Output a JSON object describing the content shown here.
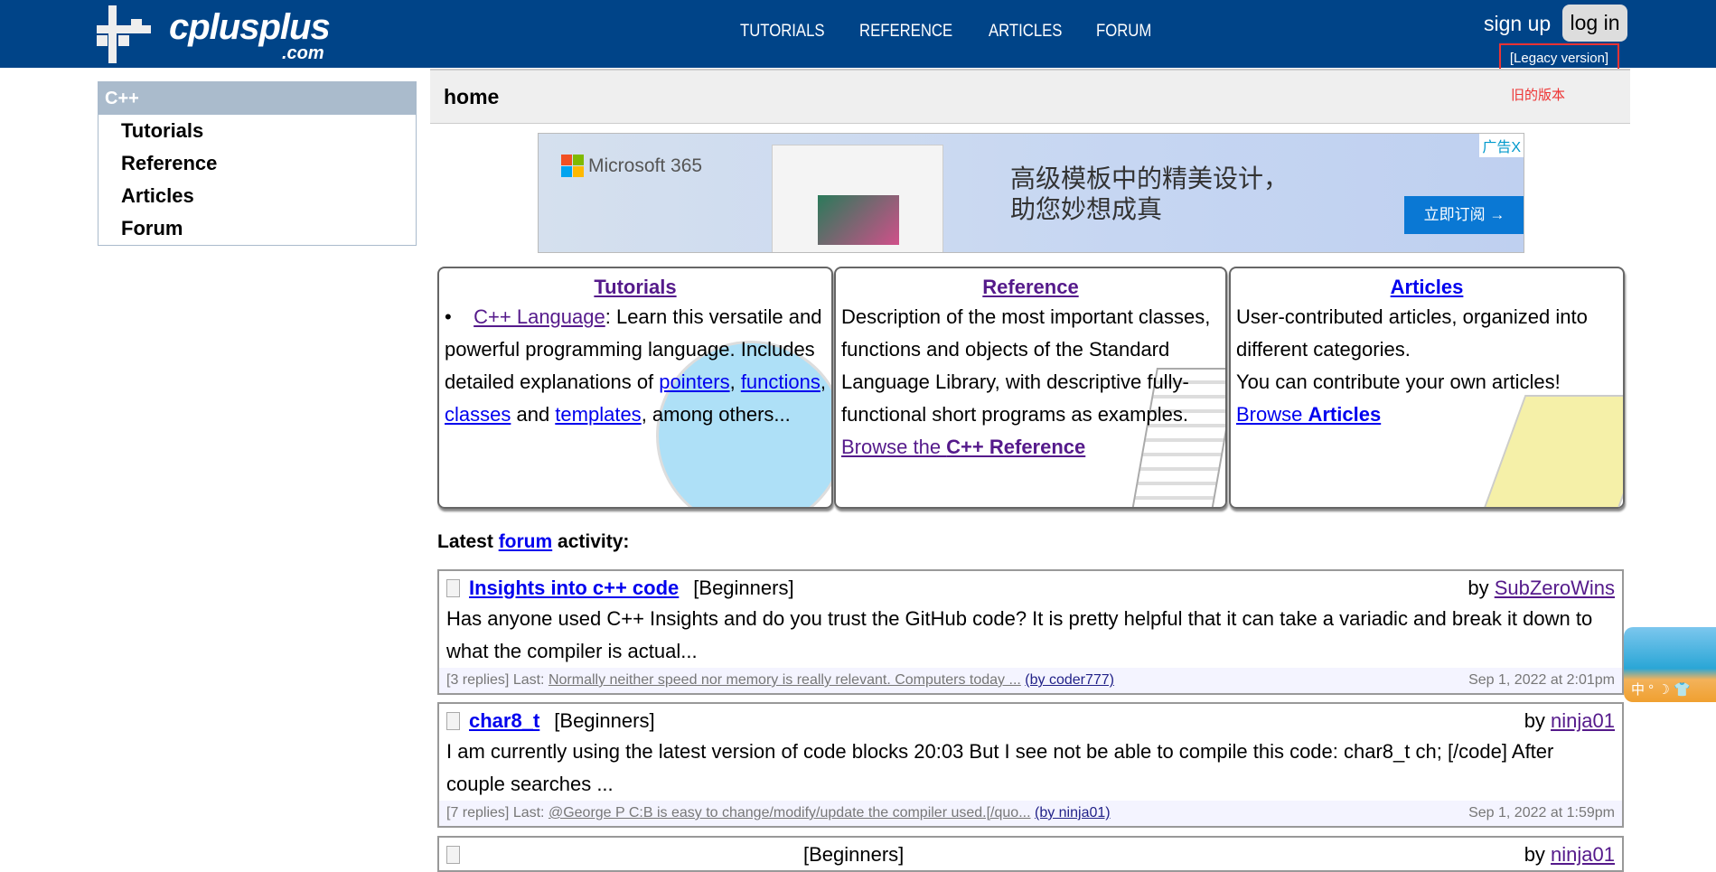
{
  "header": {
    "logo_text": "cplusplus",
    "logo_suffix": ".com",
    "nav": [
      "TUTORIALS",
      "REFERENCE",
      "ARTICLES",
      "FORUM"
    ],
    "sign_up": "sign up",
    "log_in": "log in",
    "legacy": "[Legacy version]",
    "legacy_note": "旧的版本"
  },
  "sidebar": {
    "title": "C++",
    "items": [
      "Tutorials",
      "Reference",
      "Articles",
      "Forum"
    ]
  },
  "page_title": "home",
  "ad": {
    "brand": "Microsoft 365",
    "headline_1": "高级模板中的精美设计，",
    "headline_2": "助您妙想成真",
    "cta": "立即订阅 →",
    "badge": "广告",
    "close": "X"
  },
  "boxes": {
    "tutorials": {
      "title": "Tutorials",
      "link": "C++ Language",
      "text1": ": Learn this versatile and powerful programming language. Includes detailed explanations of ",
      "links": [
        "pointers",
        "functions",
        "classes"
      ],
      "sep": ", ",
      "and": " and ",
      "last_link": "templates",
      "text2": ", among others..."
    },
    "reference": {
      "title": "Reference",
      "text": "Description of the most important classes, functions and objects of the Standard Language Library, with descriptive fully-functional short programs as examples.",
      "browse_prefix": "Browse the ",
      "browse_bold": "C++ Reference"
    },
    "articles": {
      "title": "Articles",
      "text1": "User-contributed articles, organized into different categories.",
      "text2": "You can contribute your own articles!",
      "browse_prefix": "Browse ",
      "browse_bold": "Articles"
    }
  },
  "forum": {
    "latest_prefix": "Latest ",
    "latest_link": "forum",
    "latest_suffix": " activity:",
    "posts": [
      {
        "title": "Insights into c++ code",
        "category": "[Beginners]",
        "by": "by ",
        "author": "SubZeroWins",
        "excerpt": "Has anyone used C++ Insights and do you trust the GitHub code? It is pretty helpful that it can take a variadic and break it down to what the compiler is actual...",
        "replies": "[3 replies] Last: ",
        "last": "Normally neither speed nor memory is really relevant. Computers today ...",
        "last_by": "(by coder777)",
        "date": "Sep 1, 2022 at 2:01pm"
      },
      {
        "title": "char8_t",
        "category": "[Beginners]",
        "by": "by ",
        "author": "ninja01",
        "excerpt": "I am currently using the latest version of code blocks 20:03 But I see not be able to compile this code: char8_t ch; [/code] After couple searches ...",
        "replies": "[7 replies] Last: ",
        "last": "@George P C:B is easy to change/modify/update the compiler used.[/quo...",
        "last_by": "(by ninja01)",
        "date": "Sep 1, 2022 at 1:59pm"
      },
      {
        "category": "[Beginners]",
        "by": "by ",
        "author": "ninja01"
      }
    ]
  },
  "widget": {
    "text": "中 ° ☽ 👕"
  }
}
